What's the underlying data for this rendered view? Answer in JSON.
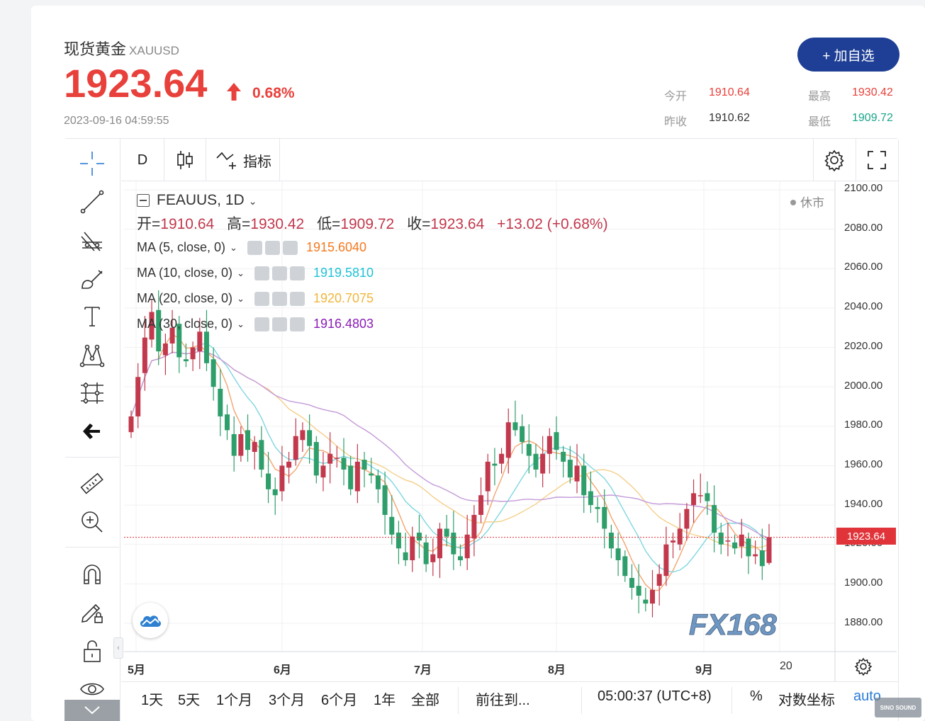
{
  "header": {
    "name": "现货黄金",
    "symbol": "XAUUSD",
    "price": "1923.64",
    "change_pct": "0.68%",
    "timestamp": "2023-09-16 04:59:55",
    "add_button": "+ 加自选"
  },
  "stats": {
    "open_label": "今开",
    "open_value": "1910.64",
    "high_label": "最高",
    "high_value": "1930.42",
    "prev_label": "昨收",
    "prev_value": "1910.62",
    "low_label": "最低",
    "low_value": "1909.72"
  },
  "toolbar": {
    "interval": "D",
    "indicators_label": "指标"
  },
  "legend": {
    "symbol_line": "FEAUUS, 1D",
    "open_label": "开=",
    "open": "1910.64",
    "high_label": "高=",
    "high": "1930.42",
    "low_label": "低=",
    "low": "1909.72",
    "close_label": "收=",
    "close": "1923.64",
    "change": "+13.02 (+0.68%)",
    "market_status": "休市",
    "ma": [
      {
        "label": "MA (5, close, 0)",
        "value": "1915.6040",
        "color": "#f4791f"
      },
      {
        "label": "MA (10, close, 0)",
        "value": "1919.5810",
        "color": "#1ec2d6"
      },
      {
        "label": "MA (20, close, 0)",
        "value": "1920.7075",
        "color": "#f2b53b"
      },
      {
        "label": "MA (30, close, 0)",
        "value": "1916.4803",
        "color": "#8b1bb5"
      }
    ]
  },
  "axis": {
    "price_labels": [
      "2100.00",
      "2080.00",
      "2060.00",
      "2040.00",
      "2020.00",
      "2000.00",
      "1980.00",
      "1960.00",
      "1940.00",
      "1920.00",
      "1900.00",
      "1880.00"
    ],
    "current_price_tag": "1923.64",
    "date_labels": [
      "5月",
      "6月",
      "7月",
      "8月",
      "9月",
      "20"
    ]
  },
  "range_bar": {
    "items": [
      "1天",
      "5天",
      "1个月",
      "3个月",
      "6个月",
      "1年",
      "全部"
    ],
    "goto": "前往到...",
    "clock": "05:00:37 (UTC+8)",
    "percent": "%",
    "log": "对数坐标",
    "auto": "auto"
  },
  "watermark": {
    "logo": "FX168",
    "badge": "SINO SOUND"
  },
  "colors": {
    "up": "#c2384c",
    "down": "#2e9e6a",
    "accent": "#1e3f95",
    "price_red": "#e8403b"
  },
  "chart_data": {
    "type": "candlestick",
    "interval": "1D",
    "ylim": [
      1870,
      2100
    ],
    "x_ticks": [
      "5月",
      "6月",
      "7月",
      "8月",
      "9月",
      "20"
    ],
    "last": {
      "open": 1910.64,
      "high": 1930.42,
      "low": 1909.72,
      "close": 1923.64
    },
    "ma_last": {
      "MA5": 1915.604,
      "MA10": 1919.581,
      "MA20": 1920.7075,
      "MA30": 1916.4803
    },
    "closes": [
      1985,
      2005,
      2025,
      2038,
      2018,
      2022,
      2030,
      2015,
      2013,
      2020,
      2028,
      2012,
      2000,
      1985,
      1978,
      1965,
      1976,
      1968,
      1972,
      1958,
      1948,
      1945,
      1960,
      1962,
      1975,
      1978,
      1970,
      1955,
      1960,
      1966,
      1964,
      1958,
      1948,
      1962,
      1958,
      1955,
      1948,
      1935,
      1925,
      1918,
      1912,
      1924,
      1922,
      1910,
      1915,
      1928,
      1924,
      1915,
      1912,
      1925,
      1935,
      1945,
      1962,
      1960,
      1966,
      1982,
      1978,
      1972,
      1965,
      1958,
      1966,
      1975,
      1968,
      1962,
      1954,
      1960,
      1945,
      1940,
      1938,
      1928,
      1918,
      1912,
      1904,
      1898,
      1894,
      1890,
      1897,
      1905,
      1920,
      1922,
      1928,
      1938,
      1946,
      1945,
      1942,
      1926,
      1920,
      1922,
      1918,
      1925,
      1914,
      1915,
      1909,
      1924
    ]
  }
}
